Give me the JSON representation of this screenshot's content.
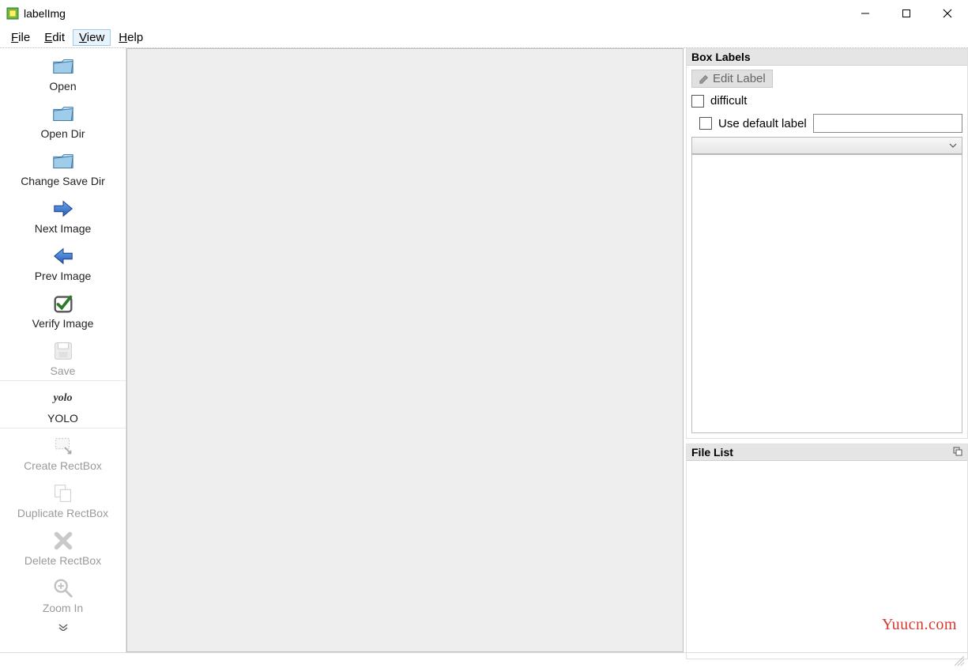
{
  "title": "labelImg",
  "menubar": {
    "file": "File",
    "edit": "Edit",
    "view": "View",
    "help": "Help"
  },
  "toolbar": [
    {
      "id": "open",
      "label": "Open",
      "icon": "folder",
      "enabled": true
    },
    {
      "id": "open-dir",
      "label": "Open Dir",
      "icon": "folder",
      "enabled": true
    },
    {
      "id": "change-save-dir",
      "label": "Change Save Dir",
      "icon": "folder",
      "enabled": true
    },
    {
      "id": "next-image",
      "label": "Next Image",
      "icon": "arrow-r",
      "enabled": true
    },
    {
      "id": "prev-image",
      "label": "Prev Image",
      "icon": "arrow-l",
      "enabled": true
    },
    {
      "id": "verify-image",
      "label": "Verify Image",
      "icon": "check",
      "enabled": true
    },
    {
      "id": "save",
      "label": "Save",
      "icon": "save",
      "enabled": false
    },
    {
      "id": "yolo",
      "label": "YOLO",
      "icon": "yolo",
      "enabled": true
    },
    {
      "id": "create-rectbox",
      "label": "Create RectBox",
      "icon": "rect",
      "enabled": false
    },
    {
      "id": "duplicate-rectbox",
      "label": "Duplicate RectBox",
      "icon": "dup",
      "enabled": false
    },
    {
      "id": "delete-rectbox",
      "label": "Delete RectBox",
      "icon": "delete",
      "enabled": false
    },
    {
      "id": "zoom-in",
      "label": "Zoom In",
      "icon": "zoom",
      "enabled": false
    }
  ],
  "panels": {
    "box_labels": {
      "title": "Box Labels",
      "edit_label": "Edit Label",
      "difficult": {
        "label": "difficult",
        "checked": false
      },
      "use_default_label": {
        "label": "Use default label",
        "checked": false,
        "value": ""
      }
    },
    "file_list": {
      "title": "File List"
    }
  },
  "watermark": "Yuucn.com"
}
